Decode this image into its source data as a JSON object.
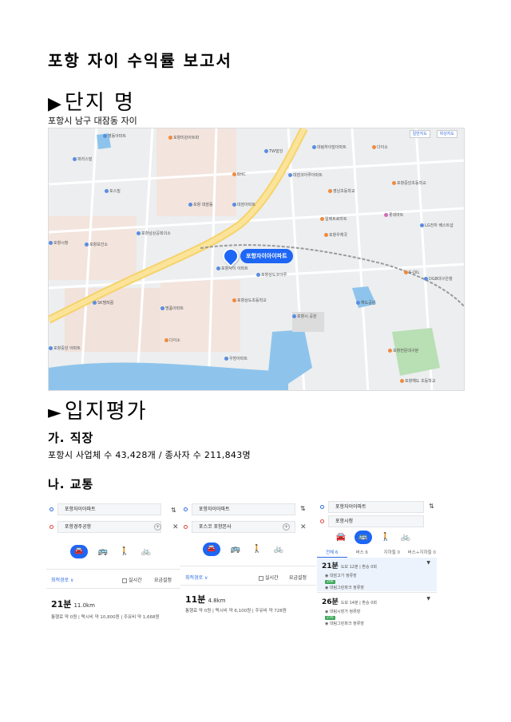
{
  "title": "포항 자이 수익률 보고서",
  "section1": {
    "marker": "▶",
    "heading": "단지 명",
    "subtitle": "포항시 남구 대잠동 자이"
  },
  "map": {
    "controls": [
      "일반지도",
      "위성지도"
    ],
    "pin_label": "포항자이아이파트",
    "pois": [
      {
        "label": "영동아파트",
        "kind": "b"
      },
      {
        "label": "포항미강아트파",
        "kind": "o"
      },
      {
        "label": "TW빌딩",
        "kind": "b"
      },
      {
        "label": "대림하이빌아파트",
        "kind": "b"
      },
      {
        "label": "다이소",
        "kind": "o"
      },
      {
        "label": "파리스빌",
        "kind": "b"
      },
      {
        "label": "BHC",
        "kind": "o"
      },
      {
        "label": "포스빌",
        "kind": "b"
      },
      {
        "label": "대잠코아루아파트",
        "kind": "b"
      },
      {
        "label": "포항중앙초등학교",
        "kind": "o"
      },
      {
        "label": "영남초등학교",
        "kind": "o"
      },
      {
        "label": "포항 대잠동",
        "kind": "b"
      },
      {
        "label": "대잠아파트",
        "kind": "b"
      },
      {
        "label": "일렉트로마트",
        "kind": "o"
      },
      {
        "label": "포항남상공회의소",
        "kind": "b"
      },
      {
        "label": "롯데마트",
        "kind": "p"
      },
      {
        "label": "포항보건소",
        "kind": "b"
      },
      {
        "label": "포항우체국",
        "kind": "o"
      },
      {
        "label": "포항시청",
        "kind": "b"
      },
      {
        "label": "LG전자 베스트샵",
        "kind": "b"
      },
      {
        "label": "S-OIL",
        "kind": "o"
      },
      {
        "label": "DGB대구은행",
        "kind": "b"
      },
      {
        "label": "포항자이 아파트",
        "kind": "b"
      },
      {
        "label": "포항상도코아루",
        "kind": "b"
      },
      {
        "label": "SK텔레콤",
        "kind": "b"
      },
      {
        "label": "해도공원",
        "kind": "b"
      },
      {
        "label": "포항시 공원",
        "kind": "b"
      },
      {
        "label": "명품아파트",
        "kind": "b"
      },
      {
        "label": "포항상도초등학교",
        "kind": "o"
      },
      {
        "label": "다이소",
        "kind": "o"
      },
      {
        "label": "포항중앙 아파트",
        "kind": "b"
      },
      {
        "label": "우방아파트",
        "kind": "b"
      },
      {
        "label": "포항전문대구분",
        "kind": "o"
      },
      {
        "label": "포항해도 초등학교",
        "kind": "o"
      }
    ]
  },
  "section2": {
    "marker": "►",
    "heading": "입지평가"
  },
  "jobs": {
    "heading": "가. 직장",
    "text": "포항시 사업체 수 43,428개 / 종사자 수 211,843명"
  },
  "transport": {
    "heading": "나. 교통"
  },
  "routes": [
    {
      "from": "포항자이아파트",
      "to": "포항경주공항",
      "option_label": "최적경로 ∨",
      "realtime": "실시간",
      "fare_setting": "요금설정",
      "time": "21분",
      "distance": "11.0km",
      "fare": "통행료 약 0원 | 택시비 약 10,800원 | 주유비 약 1,668원"
    },
    {
      "from": "포항자이아파트",
      "to": "포스코 포항본사",
      "option_label": "최적경로 ∨",
      "realtime": "실시간",
      "fare_setting": "요금설정",
      "time": "11분",
      "distance": "4.8km",
      "fare": "통행료 약 0원 | 택시비 약 6,100원 | 주유비 약 728원"
    },
    {
      "from": "포항자이아파트",
      "to": "포항시청",
      "tabs": [
        "전체 6",
        "버스 6",
        "지하철 0",
        "버스+지하철 0"
      ],
      "options": [
        {
          "time": "21분",
          "detail": "도보 12분 | 환승 0회",
          "bus": "206",
          "stop1": "대잠고가 정류장",
          "stop2": "대림그린파크 정류장"
        },
        {
          "time": "26분",
          "detail": "도보 14분 | 환승 0회",
          "bus": "216",
          "stop1": "대림시장가 정류장",
          "stop2": "대림그린파크 정류장"
        }
      ]
    }
  ],
  "colors": {
    "accent": "#1e66f5",
    "route_blue": "#2f6de0",
    "water": "#8ec4ec",
    "park": "#b9dfb4"
  }
}
